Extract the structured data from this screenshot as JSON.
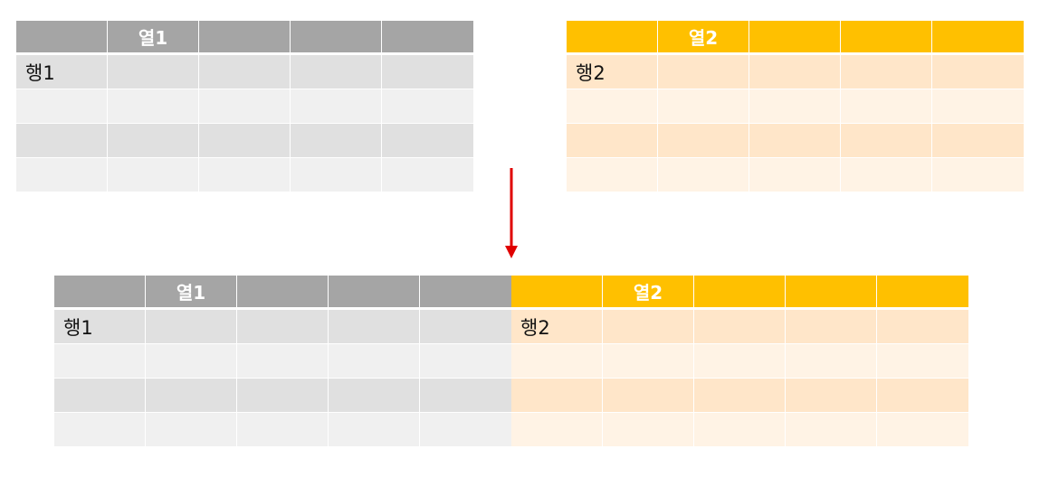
{
  "left_table": {
    "col_header": "열1",
    "row_label": "행1"
  },
  "right_table": {
    "col_header": "열2",
    "row_label": "행2"
  },
  "merged_table": {
    "left_col_header": "열1",
    "left_row_label": "행1",
    "right_col_header": "열2",
    "right_row_label": "행2"
  },
  "colors": {
    "gray_header": "#a5a5a5",
    "gray_band": "#e0e0e0",
    "gray_light": "#f0f0f0",
    "orange_header": "#ffc000",
    "orange_band": "#ffe6c9",
    "orange_light": "#fff3e5",
    "arrow": "#e00000"
  }
}
